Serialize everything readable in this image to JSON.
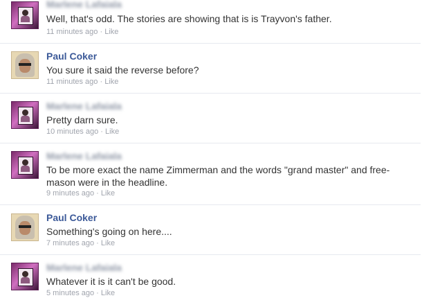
{
  "comments": [
    {
      "name": "Marlene Lafaiala",
      "body": "Well, that's odd.  The stories are showing that is is Trayvon's father.",
      "time": "11 minutes ago",
      "sep": "·",
      "like": "Like"
    },
    {
      "name": "Paul Coker",
      "body": "You sure it said the reverse before?",
      "time": "11 minutes ago",
      "sep": "·",
      "like": "Like"
    },
    {
      "name": "Marlene Lafaiala",
      "body": "Pretty darn sure.",
      "time": "10 minutes ago",
      "sep": "·",
      "like": "Like"
    },
    {
      "name": "Marlene Lafaiala",
      "body": "To be more exact the name Zimmerman and the words \"grand master\" and free-mason were in the headline.",
      "time": "9 minutes ago",
      "sep": "·",
      "like": "Like"
    },
    {
      "name": "Paul Coker",
      "body": "Something's going on here....",
      "time": "7 minutes ago",
      "sep": "·",
      "like": "Like"
    },
    {
      "name": "Marlene Lafaiala",
      "body": "Whatever it is it can't be good.",
      "time": "5 minutes ago",
      "sep": "·",
      "like": "Like"
    }
  ],
  "colors": {
    "name_link": "#3b5998",
    "meta": "#a0a4ad",
    "divider": "#e6e9ef"
  }
}
